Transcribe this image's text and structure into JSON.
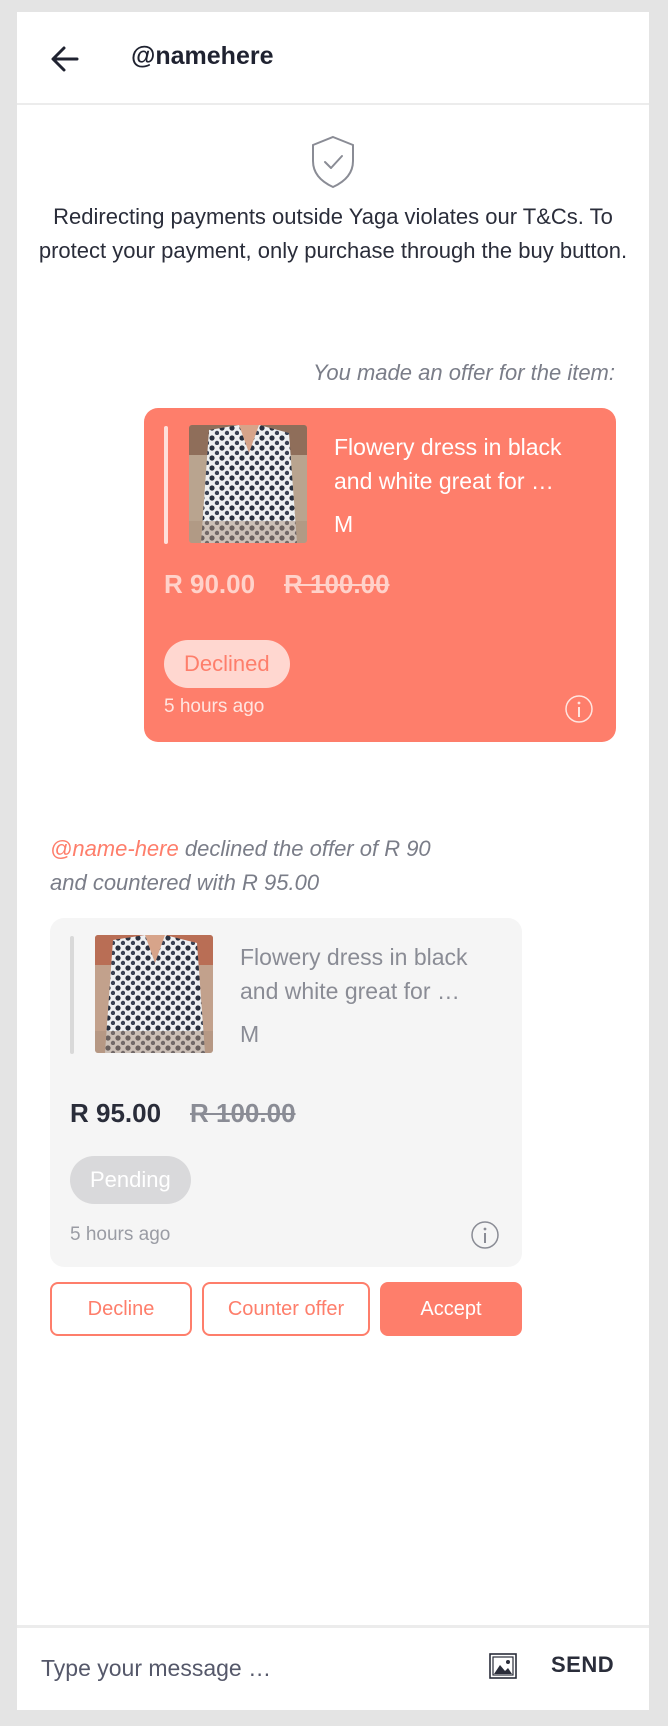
{
  "header": {
    "title": "@namehere",
    "back_icon": "arrow-left-icon"
  },
  "notice": {
    "icon": "shield-check-icon",
    "text": "Redirecting payments outside Yaga violates our T&Cs. To protect your payment, only purchase through the buy button."
  },
  "my_offer": {
    "intro": "You made an offer for the item:",
    "item_title_line1": "Flowery dress in black",
    "item_title_line2": "and white great for …",
    "item_size": "M",
    "offer_price": "R 90.00",
    "original_price": "R 100.00",
    "status": "Declined",
    "timestamp": "5 hours ago"
  },
  "counter": {
    "handle": "@name-here",
    "message_line1": " declined the offer of R 90",
    "message_line2": "and countered with R 95.00",
    "item_title_line1": "Flowery dress in black",
    "item_title_line2": "and white great for …",
    "item_size": "M",
    "offer_price": "R 95.00",
    "original_price": "R 100.00",
    "status": "Pending",
    "timestamp": "5 hours ago"
  },
  "actions": {
    "decline": "Decline",
    "counter_offer": "Counter offer",
    "accept": "Accept"
  },
  "composer": {
    "placeholder": "Type your message …",
    "send_label": "SEND",
    "attach_icon": "image-icon"
  },
  "colors": {
    "accent": "#fe7e6b",
    "accent_light": "#ffd7d0",
    "card_grey": "#f5f5f5",
    "text_dark": "#2a2d3a",
    "text_muted": "#7a7d88"
  }
}
